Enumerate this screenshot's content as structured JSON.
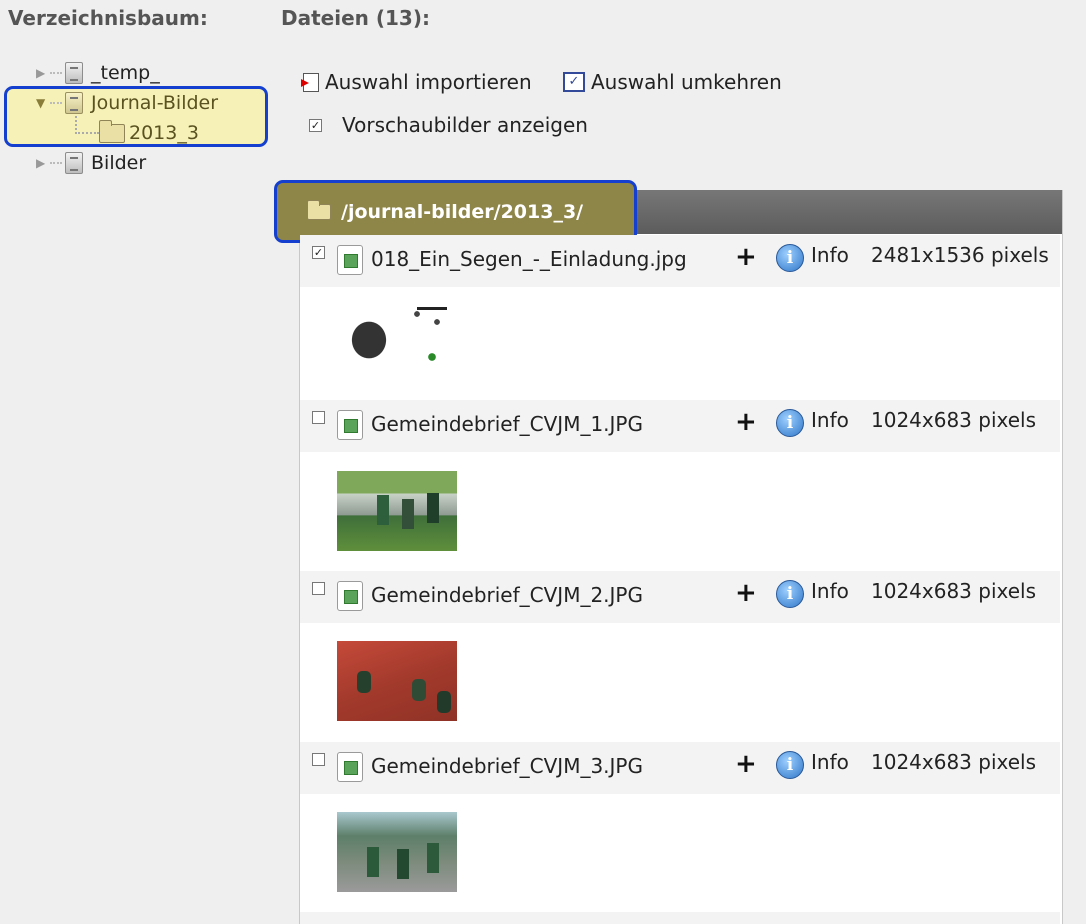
{
  "headings": {
    "tree": "Verzeichnisbaum:",
    "files": "Dateien (13):"
  },
  "tree": {
    "items": [
      {
        "label": "_temp_",
        "expanded": false,
        "selected": false,
        "icon": "drive-icon"
      },
      {
        "label": "Journal-Bilder",
        "expanded": true,
        "selected": true,
        "icon": "drive-icon"
      },
      {
        "label": "2013_3",
        "expanded": false,
        "selected": true,
        "icon": "folder-icon"
      },
      {
        "label": "Bilder",
        "expanded": false,
        "selected": false,
        "icon": "drive-icon"
      }
    ]
  },
  "actions": {
    "import_label": "Auswahl importieren",
    "invert_label": "Auswahl umkehren",
    "thumbnails_label": "Vorschaubilder anzeigen",
    "thumbnails_checked": true
  },
  "path": "/journal-bilder/2013_3/",
  "files": [
    {
      "name": "018_Ein_Segen_-_Einladung.jpg",
      "checked": true,
      "plus": "+",
      "info": "Info",
      "dims": "2481x1536 pixels"
    },
    {
      "name": "Gemeindebrief_CVJM_1.JPG",
      "checked": false,
      "plus": "+",
      "info": "Info",
      "dims": "1024x683 pixels"
    },
    {
      "name": "Gemeindebrief_CVJM_2.JPG",
      "checked": false,
      "plus": "+",
      "info": "Info",
      "dims": "1024x683 pixels"
    },
    {
      "name": "Gemeindebrief_CVJM_3.JPG",
      "checked": false,
      "plus": "+",
      "info": "Info",
      "dims": "1024x683 pixels"
    }
  ],
  "colors": {
    "highlight_border": "#1540cf",
    "tree_highlight": "#f6f1b7",
    "path_highlight": "#8e8548",
    "path_bar": "#666666"
  }
}
